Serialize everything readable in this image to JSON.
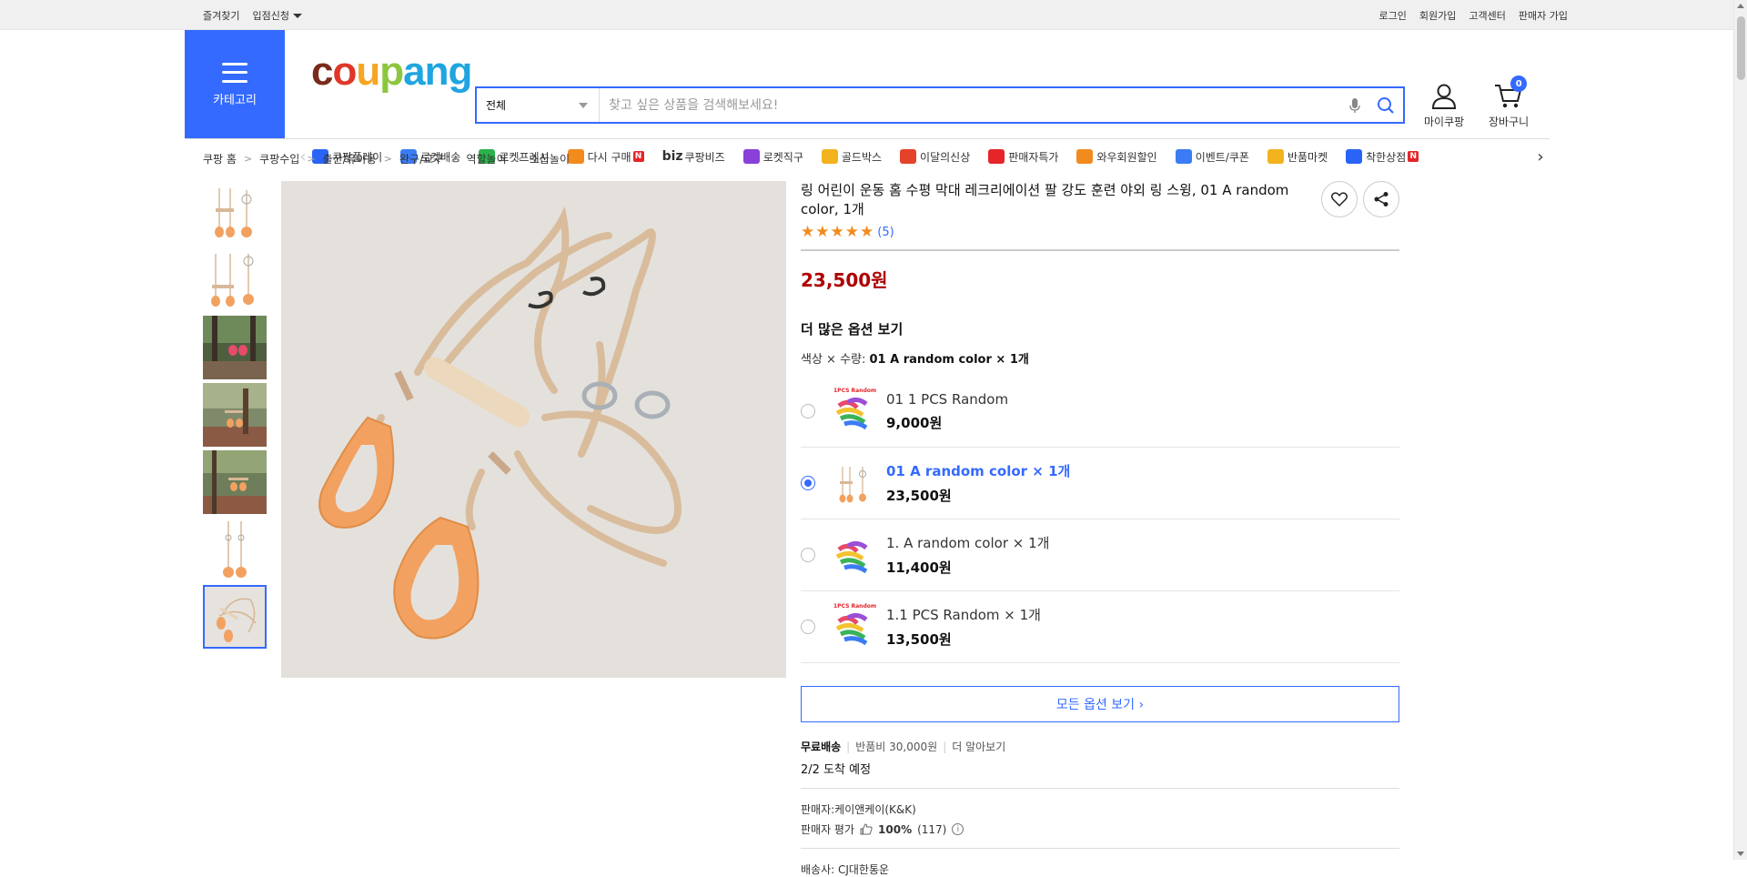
{
  "topbar": {
    "left": [
      "즐겨찾기",
      "입점신청"
    ],
    "right": [
      "로그인",
      "회원가입",
      "고객센터",
      "판매자 가입"
    ]
  },
  "header": {
    "category_label": "카테고리",
    "logo": [
      "c",
      "o",
      "u",
      "p",
      "ang"
    ],
    "search": {
      "category": "전체",
      "placeholder": "찾고 싶은 상품을 검색해보세요!"
    },
    "mycoupang_label": "마이쿠팡",
    "cart_label": "장바구니",
    "cart_count": "0"
  },
  "nav": [
    {
      "label": "쿠팡플레이",
      "color": "#2a64f6",
      "badge": ""
    },
    {
      "label": "로켓배송",
      "color": "#3b7cf5",
      "badge": ""
    },
    {
      "label": "로켓프레시",
      "color": "#2bb24c",
      "badge": ""
    },
    {
      "label": "다시 구매",
      "color": "#f28b1e",
      "badge": "N"
    },
    {
      "label": "쿠팡비즈",
      "color": "#555555",
      "badge": "",
      "prefix": "biz"
    },
    {
      "label": "로켓직구",
      "color": "#8b3fd9",
      "badge": ""
    },
    {
      "label": "골드박스",
      "color": "#f2b31e",
      "badge": ""
    },
    {
      "label": "이달의신상",
      "color": "#e5422b",
      "badge": ""
    },
    {
      "label": "판매자특가",
      "color": "#e5252a",
      "badge": ""
    },
    {
      "label": "와우회원할인",
      "color": "#f28b1e",
      "badge": ""
    },
    {
      "label": "이벤트/쿠폰",
      "color": "#3b7cf5",
      "badge": ""
    },
    {
      "label": "반품마켓",
      "color": "#f2b31e",
      "badge": ""
    },
    {
      "label": "착한상점",
      "color": "#2a64f6",
      "badge": "N"
    }
  ],
  "breadcrumb": [
    "쿠팡 홈",
    "쿠팡수입",
    "출산/유아동",
    "완구/교구",
    "역할놀이",
    "소꿉놀이"
  ],
  "product": {
    "title": "링 어린이 운동 홈 수평 막대 레크리에이션 팔 강도 훈련 야외 링 스윙, 01 A random color, 1개",
    "rating": 5,
    "review_count": "(5)",
    "price": "23,500원",
    "more_options_title": "더 많은 옵션 보기",
    "selected_prefix": "색상 × 수량: ",
    "selected_value": "01 A random color × 1개",
    "options": [
      {
        "name": "01 1 PCS Random",
        "price": "9,000원",
        "selected": false,
        "img_caption": "1PCS Random"
      },
      {
        "name": "01 A random color × 1개",
        "price": "23,500원",
        "selected": true,
        "img_caption": ""
      },
      {
        "name": "1. A random color × 1개",
        "price": "11,400원",
        "selected": false,
        "img_caption": ""
      },
      {
        "name": "1.1 PCS Random × 1개",
        "price": "13,500원",
        "selected": false,
        "img_caption": "1PCS Random"
      }
    ],
    "all_options_label": "모든 옵션 보기 ›",
    "shipping": {
      "free": "무료배송",
      "return_fee": "반품비 30,000원",
      "more": "더 알아보기",
      "arrival": "2/2 도착 예정"
    },
    "seller": {
      "name": "판매자:케이앤케이(K&K)",
      "rating_label": "판매자 평가",
      "rating_value": "100%",
      "rating_count": "(117)"
    },
    "cut_row": "배송사: CJ대한통운"
  },
  "colors": {
    "accent": "#346aff",
    "price": "#ae0000",
    "star": "#f28b1e",
    "rope": "#d8b898",
    "handle": "#f2a160"
  }
}
